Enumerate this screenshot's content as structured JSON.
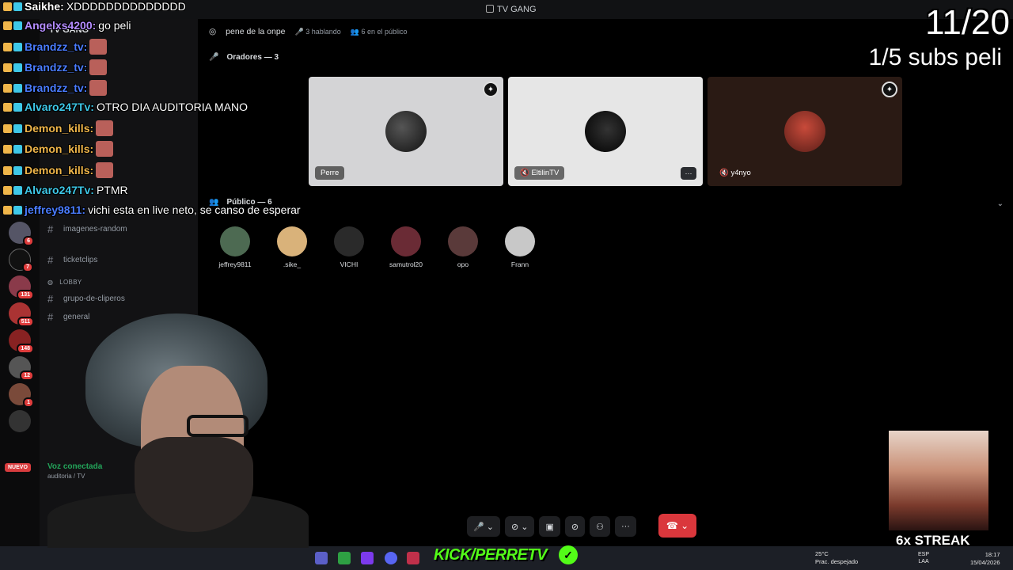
{
  "window": {
    "title": "TV GANG"
  },
  "sidebar": {
    "server_name": "TV GANG",
    "channels": [
      {
        "label": "imagenes-random",
        "type": "text"
      },
      {
        "label": "ticketclips",
        "type": "text"
      },
      {
        "label": "LOBBY",
        "type": "category"
      },
      {
        "label": "grupo-de-cliperos",
        "type": "text"
      },
      {
        "label": "general",
        "type": "text"
      }
    ],
    "guild_badges": [
      "6",
      "7",
      "131",
      "511",
      "148",
      "12",
      "1"
    ],
    "nuevo_label": "NUEVO",
    "voice_connected": "Voz conectada",
    "voice_sub": "auditoria / TV"
  },
  "stage": {
    "name": "pene de la onpe",
    "speaking": "3 hablando",
    "audience_count": "6 en el público",
    "speakers_title": "Oradores — 3",
    "audience_title": "Público — 6",
    "speakers": [
      {
        "name": "Perre",
        "bg": "#d4d4d6"
      },
      {
        "name": "EltilinTV",
        "bg": "#e6e6e6"
      },
      {
        "name": "y4nyo",
        "bg": "#2a1a14"
      }
    ],
    "audience": [
      {
        "name": "jeffrey9811",
        "color": "#4d6a52"
      },
      {
        "name": ".sike_",
        "color": "#d9b27a"
      },
      {
        "name": "VICHI",
        "color": "#2a2a2a"
      },
      {
        "name": "samutrol20",
        "color": "#6a2b35"
      },
      {
        "name": "opo",
        "color": "#5a3a3a"
      },
      {
        "name": "Frann",
        "color": "#c8c8c8"
      }
    ],
    "more_icon": "···"
  },
  "overlay": {
    "counter": "11/20",
    "subs_text": "1/5 subs peli",
    "streak": "6x STREAK",
    "brand": "KICK/PERRETV",
    "chat": [
      {
        "user": "Saikhe:",
        "message": "XDDDDDDDDDDDDDD",
        "color": "#ffffff",
        "emote": false
      },
      {
        "user": "Angelxs4200:",
        "message": "go peli",
        "color": "#b48cff",
        "emote": false
      },
      {
        "user": "Brandzz_tv:",
        "message": "",
        "color": "#4a7cff",
        "emote": true
      },
      {
        "user": "Brandzz_tv:",
        "message": "",
        "color": "#4a7cff",
        "emote": true
      },
      {
        "user": "Brandzz_tv:",
        "message": "",
        "color": "#4a7cff",
        "emote": true
      },
      {
        "user": "Alvaro247Tv:",
        "message": "OTRO DIA AUDITORIA MANO",
        "color": "#3ec8e8",
        "emote": false
      },
      {
        "user": "Demon_kills:",
        "message": "",
        "color": "#f0b64a",
        "emote": true
      },
      {
        "user": "Demon_kills:",
        "message": "",
        "color": "#f0b64a",
        "emote": true
      },
      {
        "user": "Demon_kills:",
        "message": "",
        "color": "#f0b64a",
        "emote": true
      },
      {
        "user": "Alvaro247Tv:",
        "message": "PTMR",
        "color": "#3ec8e8",
        "emote": false
      },
      {
        "user": "jeffrey9811:",
        "message": "vichi esta en live neto, se canso de esperar",
        "color": "#4a7cff",
        "emote": false
      }
    ]
  },
  "taskbar": {
    "temp": "25°C",
    "weather": "Prac. despejado",
    "lang": "ESP",
    "lang_sub": "LAA",
    "time": "18:17",
    "date": "15/04/2026"
  }
}
